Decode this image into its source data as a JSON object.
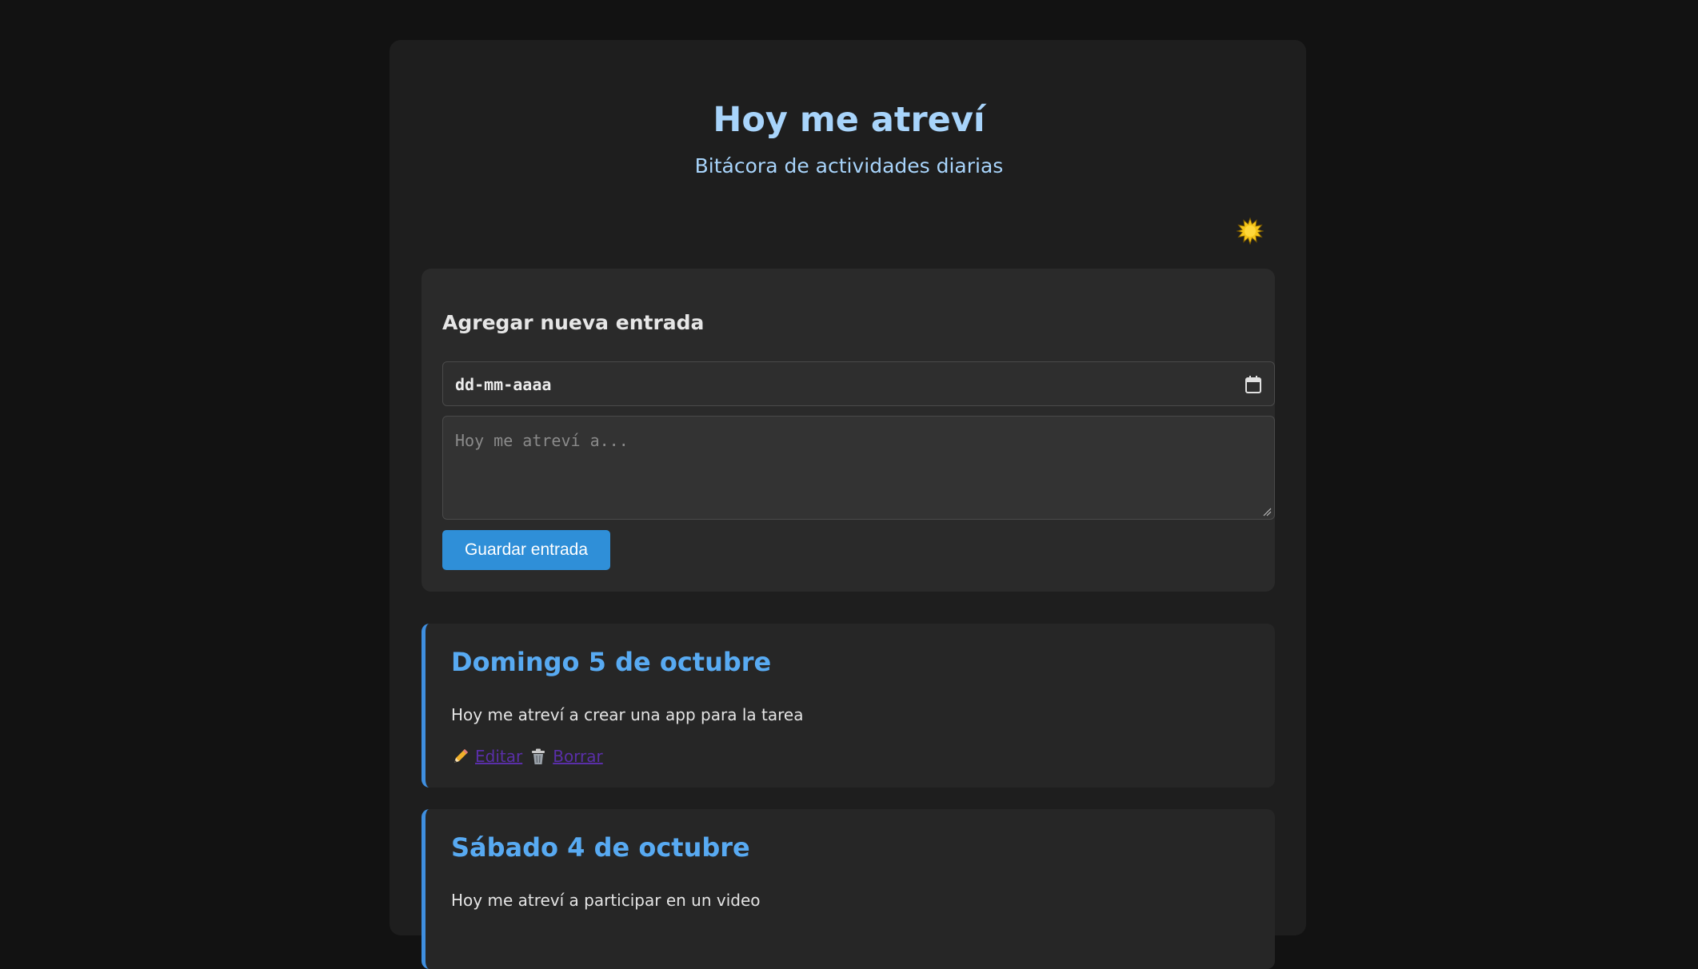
{
  "header": {
    "title": "Hoy me atreví",
    "subtitle": "Bitácora de actividades diarias"
  },
  "theme_toggle": {
    "icon": "sun-icon",
    "color": "#f5c518"
  },
  "form": {
    "title": "Agregar nueva entrada",
    "date_value": "dd-mm-aaaa",
    "text_placeholder": "Hoy me atreví a...",
    "save_label": "Guardar entrada"
  },
  "entries": [
    {
      "title": "Domingo 5 de octubre",
      "text": "Hoy me atreví a crear una app para la tarea",
      "edit_label": "Editar",
      "delete_label": "Borrar"
    },
    {
      "title": "Sábado 4 de octubre",
      "text": "Hoy me atreví a participar en un video"
    }
  ],
  "colors": {
    "background": "#121212",
    "card": "#1e1e1e",
    "accent": "#58aaf2",
    "button": "#2f8fd8",
    "link": "#5a2fa8"
  }
}
